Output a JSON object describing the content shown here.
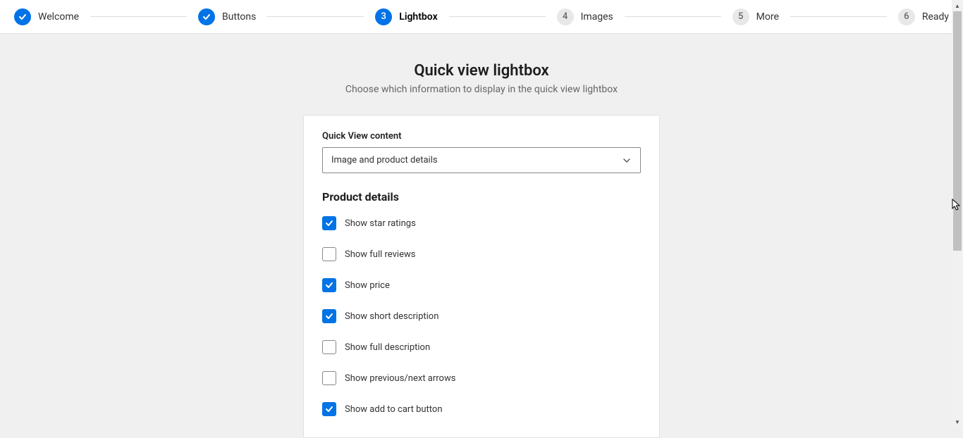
{
  "stepper": {
    "steps": [
      {
        "status": "done",
        "number": "",
        "label": "Welcome"
      },
      {
        "status": "done",
        "number": "",
        "label": "Buttons"
      },
      {
        "status": "current",
        "number": "3",
        "label": "Lightbox"
      },
      {
        "status": "future",
        "number": "4",
        "label": "Images"
      },
      {
        "status": "future",
        "number": "5",
        "label": "More"
      },
      {
        "status": "future",
        "number": "6",
        "label": "Ready"
      }
    ]
  },
  "page": {
    "title": "Quick view lightbox",
    "subtitle": "Choose which information to display in the quick view lightbox"
  },
  "form": {
    "content_label": "Quick View content",
    "content_selected": "Image and product details",
    "product_details_heading": "Product details",
    "options": [
      {
        "checked": true,
        "label": "Show star ratings"
      },
      {
        "checked": false,
        "label": "Show full reviews"
      },
      {
        "checked": true,
        "label": "Show price"
      },
      {
        "checked": true,
        "label": "Show short description"
      },
      {
        "checked": false,
        "label": "Show full description"
      },
      {
        "checked": false,
        "label": "Show previous/next arrows"
      },
      {
        "checked": true,
        "label": "Show add to cart button"
      }
    ]
  }
}
